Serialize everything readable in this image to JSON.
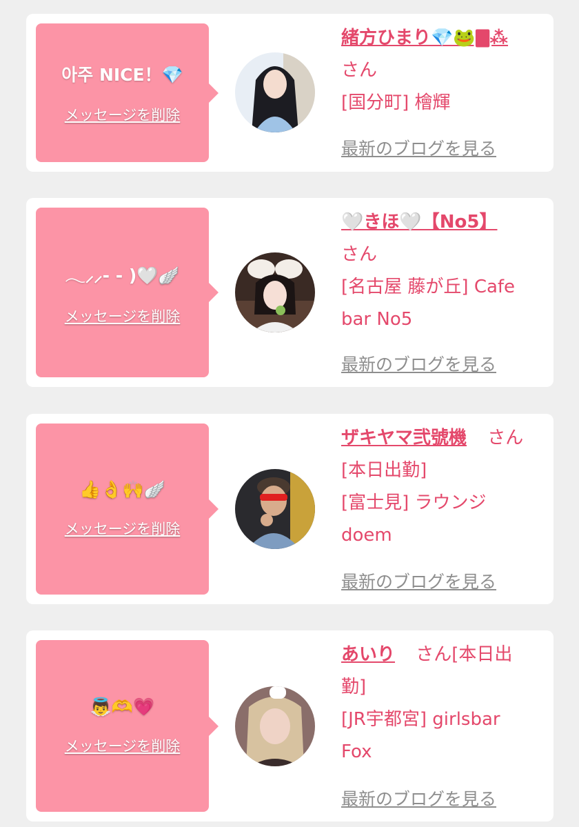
{
  "common": {
    "delete_label": "メッセージを削除",
    "blog_label": "最新のブログを見る"
  },
  "cards": [
    {
      "message": "아주 NICE！",
      "message_emoji": "💎",
      "name": "緒方ひまり💎🐸🀫⁂",
      "san": "さん",
      "lines": [
        "[国分町] 檜輝"
      ]
    },
    {
      "message": "𓂃⸝⸝- - )",
      "message_emoji": "🤍🪽",
      "name": "🤍きほ🤍【No5】",
      "san": "さん",
      "lines": [
        "[名古屋 藤が丘] Cafe",
        "bar No5"
      ]
    },
    {
      "message": "",
      "message_emoji": "👍👌🙌🪽",
      "name": "ザキヤマ弐號機",
      "san": "さん",
      "lines": [
        "[本日出勤]",
        "[富士見] ラウンジ",
        "doem"
      ]
    },
    {
      "message": "",
      "message_emoji": "👼🫶💗",
      "name": "あいり",
      "san": "さん[本日出",
      "lines": [
        "勤]",
        "[JR宇都宮] girlsbar",
        "Fox"
      ]
    }
  ],
  "colors": {
    "bubble": "#fc94a6",
    "accent": "#e4486b",
    "link_gray": "#8e8e8e",
    "background": "#efefef"
  }
}
